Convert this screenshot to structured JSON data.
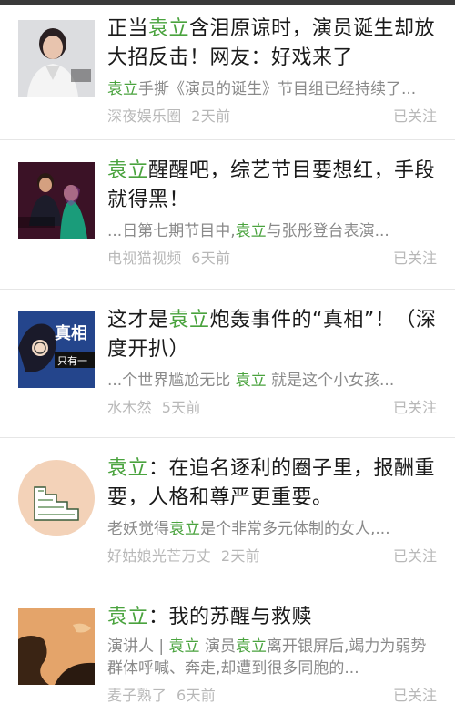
{
  "highlight_color": "#4aa33e",
  "items": [
    {
      "title_pre": "正当",
      "title_hl": "袁立",
      "title_post": "含泪原谅时，演员诞生却放大招反击！网友：好戏来了",
      "snippet_hl": "袁立",
      "snippet_post": "手撕《演员的诞生》节目组已经持续了...",
      "source": "深夜娱乐圈",
      "time": "2天前",
      "follow": "已关注",
      "thumb_icon": "woman-portrait-photo"
    },
    {
      "title_hl": "袁立",
      "title_post": "醒醒吧，综艺节目要想红，手段就得黑！",
      "snippet_pre": "...日第七期节目中,",
      "snippet_hl": "袁立",
      "snippet_post": "与张彤登台表演...",
      "source": "电视猫视频",
      "time": "6天前",
      "follow": "已关注",
      "thumb_icon": "stage-performance-photo"
    },
    {
      "title_pre": "这才是",
      "title_hl": "袁立",
      "title_post": "炮轰事件的“真相”！（深度开扒）",
      "snippet_pre": "...个世界尴尬无比 ",
      "snippet_hl": "袁立",
      "snippet_post": " 就是这个小女孩...",
      "source": "水木然",
      "time": "5天前",
      "follow": "已关注",
      "thumb_icon": "cartoon-detective-image"
    },
    {
      "title_hl": "袁立",
      "title_post": "：在追名逐利的圈子里，报酬重要，人格和尊严更重要。",
      "snippet_pre": "老妖觉得",
      "snippet_hl": "袁立",
      "snippet_post": "是个非常多元体制的女人,...",
      "source": "好姑娘光芒万丈",
      "time": "2天前",
      "follow": "已关注",
      "thumb_icon": "stairs-illustration"
    },
    {
      "title_hl": "袁立",
      "title_post": "：我的苏醒与救赎",
      "snippet_pre": "演讲人 | ",
      "snippet_hl": "袁立",
      "snippet_mid": " 演员",
      "snippet_hl2": "袁立",
      "snippet_post": "离开银屏后,竭力为弱势群体呼喊、奔走,却遭到很多同胞的...",
      "source": "麦子熟了",
      "time": "6天前",
      "follow": "已关注",
      "thumb_icon": "silhouette-illustration"
    }
  ]
}
